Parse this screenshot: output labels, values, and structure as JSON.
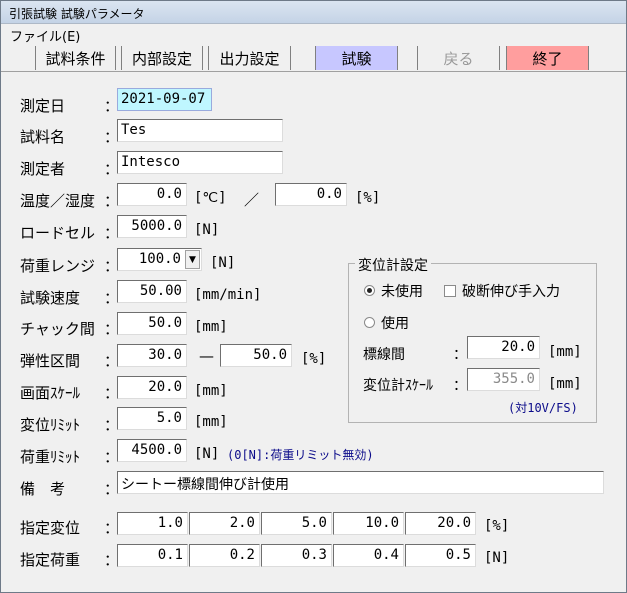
{
  "window": {
    "title": "引張試験 試験パラメータ"
  },
  "menu": {
    "file": "ファイル(E)"
  },
  "toolbar": {
    "sample_cond": "試料条件",
    "internal_settings": "内部設定",
    "output_settings": "出力設定",
    "test": "試験",
    "back": "戻る",
    "exit": "終了"
  },
  "colors": {
    "test_button": "#c7c7ff",
    "exit_button": "#ff9e9e",
    "date_field": "#bff7ff",
    "note_text": "#0b0b8a"
  },
  "form": {
    "date": {
      "label": "測定日",
      "value": "2021-09-07"
    },
    "sample_name": {
      "label": "試料名",
      "value": "Tes"
    },
    "operator": {
      "label": "測定者",
      "value": "Intesco"
    },
    "temp_humidity": {
      "label": "温度／湿度",
      "temp": "0.0",
      "temp_unit": "[℃]",
      "sep": "／",
      "humidity": "0.0",
      "humidity_unit": "[%]"
    },
    "load_cell": {
      "label": "ロードセル",
      "value": "5000.0",
      "unit": "[N]"
    },
    "load_range": {
      "label": "荷重レンジ",
      "value": "100.0",
      "unit": "[N]"
    },
    "test_speed": {
      "label": "試験速度",
      "value": "50.00",
      "unit": "[mm/min]"
    },
    "chuck_distance": {
      "label": "チャック間",
      "value": "50.0",
      "unit": "[mm]"
    },
    "elastic_range": {
      "label": "弾性区間",
      "from": "30.0",
      "dash": "—",
      "to": "50.0",
      "unit": "[%]"
    },
    "screen_scale": {
      "label": "画面ｽｹｰﾙ",
      "value": "20.0",
      "unit": "[mm]"
    },
    "disp_limit": {
      "label": "変位ﾘﾐｯﾄ",
      "value": "5.0",
      "unit": "[mm]"
    },
    "load_limit": {
      "label": "荷重ﾘﾐｯﾄ",
      "value": "4500.0",
      "unit": "[N]",
      "note": "(0[N]:荷重リミット無効)"
    },
    "remarks": {
      "label": "備　考",
      "value": "シートー標線間伸び計使用"
    },
    "specified_disp": {
      "label": "指定変位",
      "values": [
        "1.0",
        "2.0",
        "5.0",
        "10.0",
        "20.0"
      ],
      "unit": "[%]"
    },
    "specified_load": {
      "label": "指定荷重",
      "values": [
        "0.1",
        "0.2",
        "0.3",
        "0.4",
        "0.5"
      ],
      "unit": "[N]"
    },
    "colon": "："
  },
  "extensometer": {
    "title": "変位計設定",
    "unused": "未使用",
    "manual_break": "破断伸び手入力",
    "used": "使用",
    "gauge_length": {
      "label": "標線間",
      "value": "20.0",
      "unit": "[mm]"
    },
    "disp_scale": {
      "label": "変位計ｽｹｰﾙ",
      "value": "355.0",
      "unit": "[mm]"
    },
    "note": "(対10V/FS)"
  }
}
